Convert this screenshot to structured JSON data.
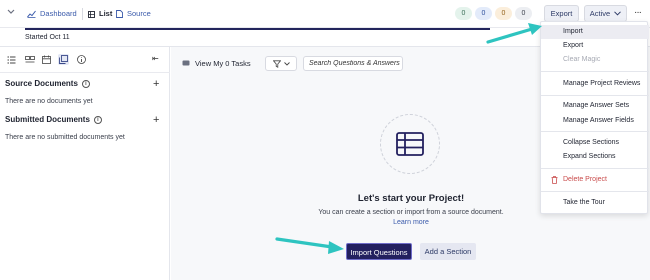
{
  "topbar": {
    "dashboard_label": "Dashboard",
    "list_label": "List",
    "source_label": "Source",
    "counts": [
      {
        "value": "0",
        "bg": "#e4f3ec",
        "fg": "#3a6e57"
      },
      {
        "value": "0",
        "bg": "#e3ebfa",
        "fg": "#2e4f9a"
      },
      {
        "value": "0",
        "bg": "#fbeedb",
        "fg": "#93611a"
      },
      {
        "value": "0",
        "bg": "#eceef2",
        "fg": "#3a3f4b"
      }
    ],
    "export_label": "Export",
    "active_label": "Active",
    "more_label": "···"
  },
  "subheader": {
    "started_text": "Started Oct 11"
  },
  "sidebar": {
    "source_title": "Source Documents",
    "source_empty": "There are no documents yet",
    "submitted_title": "Submitted Documents",
    "submitted_empty": "There are no submitted documents yet",
    "info_glyph": "i",
    "plus_glyph": "+",
    "collapse_glyph": "⇤"
  },
  "main": {
    "view_my_tasks": "View My 0 Tasks",
    "search_placeholder": "Search Questions & Answers",
    "empty_title": "Let's start your Project!",
    "empty_desc": "You can create a section or import from a source document.",
    "learn_more": "Learn more",
    "import_btn": "Import Questions",
    "add_section_btn": "Add a Section"
  },
  "menu": {
    "items": [
      {
        "label": "Import"
      },
      {
        "label": "Export"
      },
      {
        "label": "Clear Magic"
      },
      {
        "label": "Manage Project Reviews"
      },
      {
        "label": "Manage Answer Sets"
      },
      {
        "label": "Manage Answer Fields"
      },
      {
        "label": "Collapse Sections"
      },
      {
        "label": "Expand Sections"
      },
      {
        "label": "Delete Project"
      },
      {
        "label": "Take the Tour"
      }
    ]
  },
  "colors": {
    "brand_dark": "#23205f",
    "link_blue": "#3b5bab",
    "arrow_teal": "#2ec4c0",
    "danger": "#c94b4b"
  }
}
